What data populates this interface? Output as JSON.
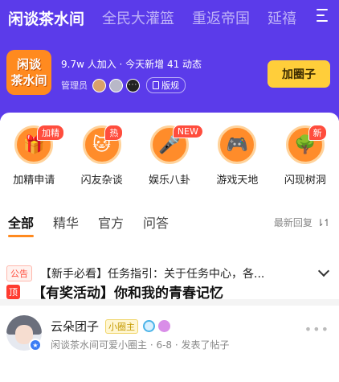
{
  "top_tabs": [
    "闲谈茶水间",
    "全民大灌篮",
    "重返帝国",
    "延禧"
  ],
  "group": {
    "logo_line1": "闲谈",
    "logo_line2": "茶水间",
    "stats": "9.7w 人加入 · 今天新增 41 动态",
    "admin_label": "管理员",
    "rules_label": "版规",
    "join_label": "加圈子"
  },
  "categories": [
    {
      "label": "加精申请",
      "badge": "加精",
      "icon": "gift-icon"
    },
    {
      "label": "闪友杂谈",
      "badge": "热",
      "icon": "cat-icon"
    },
    {
      "label": "娱乐八卦",
      "badge": "NEW",
      "icon": "microphone-icon"
    },
    {
      "label": "游戏天地",
      "badge": "",
      "icon": "gamepad-icon"
    },
    {
      "label": "闪现树洞",
      "badge": "新",
      "icon": "tree-icon"
    }
  ],
  "filter_tabs": [
    "全部",
    "精华",
    "官方",
    "问答"
  ],
  "sort_label": "最新回复",
  "notice": {
    "tag": "公告",
    "text": "【新手必看】任务指引：关于任务中心，各..."
  },
  "post": {
    "author": "云朵团子",
    "role_tag": "小圈主",
    "meta": "闲谈茶水间可爱小圈主 · 6-8 · 发表了帖子",
    "pin_tag": "顶",
    "title": "【有奖活动】你和我的青春记忆"
  },
  "colors": {
    "header_bg": "#5b3bea",
    "accent": "#ff8a1f",
    "join_button": "#ffce3a",
    "badge_red": "#ff4d3d"
  }
}
